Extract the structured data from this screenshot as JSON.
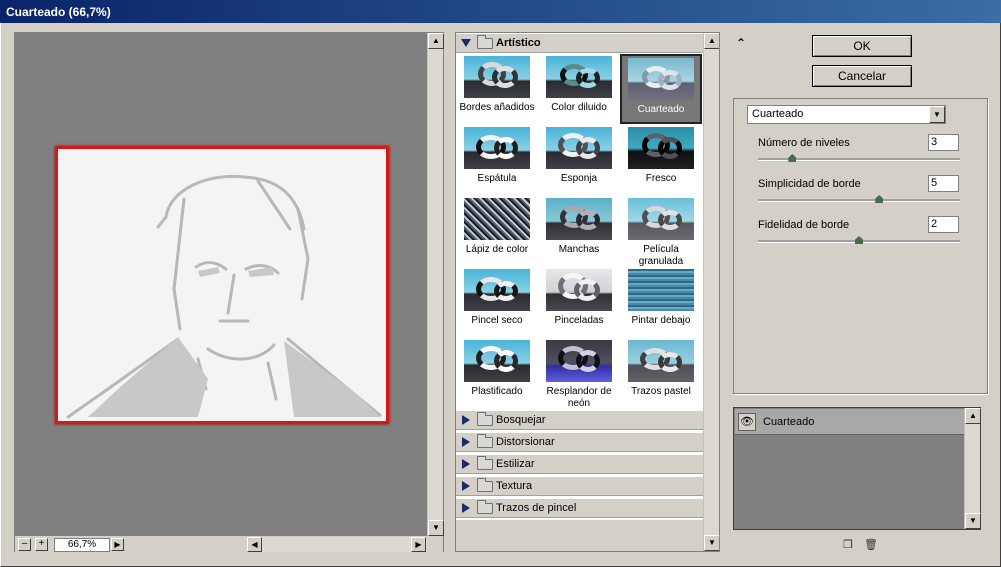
{
  "window": {
    "title": "Cuarteado (66,7%)"
  },
  "preview": {
    "zoom": "66,7%",
    "zoom_out": "–",
    "zoom_in": "+"
  },
  "gallery": {
    "open_category": "Artístico",
    "filters": [
      {
        "label": "Bordes añadidos"
      },
      {
        "label": "Color diluido"
      },
      {
        "label": "Cuarteado",
        "selected": true
      },
      {
        "label": "Espátula"
      },
      {
        "label": "Esponja"
      },
      {
        "label": "Fresco"
      },
      {
        "label": "Lápiz de color"
      },
      {
        "label": "Manchas"
      },
      {
        "label": "Película granulada"
      },
      {
        "label": "Pincel seco"
      },
      {
        "label": "Pinceladas"
      },
      {
        "label": "Pintar debajo"
      },
      {
        "label": "Plastificado"
      },
      {
        "label": "Resplandor de neón"
      },
      {
        "label": "Trazos pastel"
      }
    ],
    "categories": [
      "Bosquejar",
      "Distorsionar",
      "Estilizar",
      "Textura",
      "Trazos de pincel"
    ]
  },
  "buttons": {
    "ok": "OK",
    "cancel": "Cancelar"
  },
  "settings": {
    "filter_select": "Cuarteado",
    "params": [
      {
        "label": "Número de niveles",
        "value": "3",
        "fraction": 0.17
      },
      {
        "label": "Simplicidad de borde",
        "value": "5",
        "fraction": 0.6
      },
      {
        "label": "Fidelidad de borde",
        "value": "2",
        "fraction": 0.5
      }
    ]
  },
  "layers": {
    "items": [
      {
        "name": "Cuarteado"
      }
    ]
  },
  "colors": {
    "title_bar": "#0a246a",
    "selection": "#777777",
    "frame_red": "#d81818"
  },
  "icons": [
    "collapse-icon",
    "eye-icon",
    "new-layer-icon",
    "trash-icon",
    "folder-icon"
  ]
}
